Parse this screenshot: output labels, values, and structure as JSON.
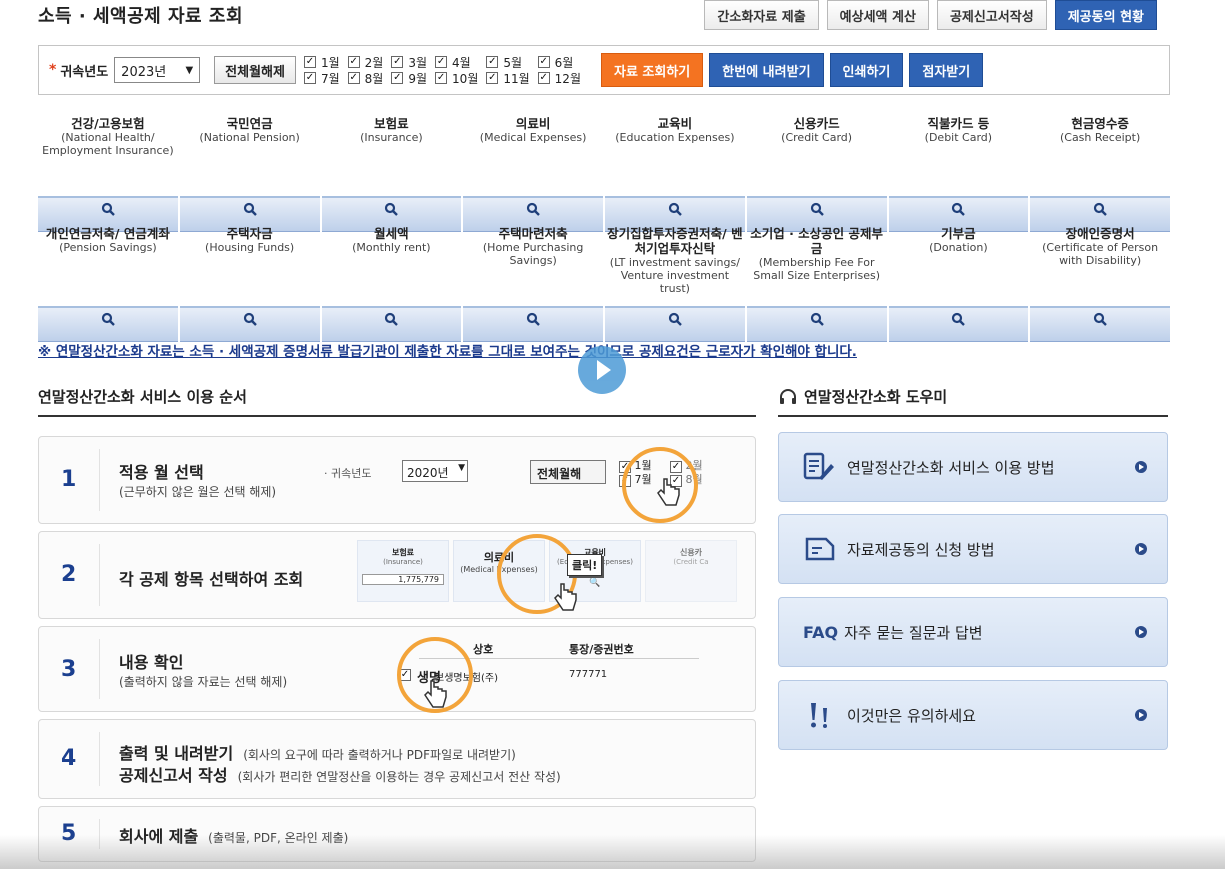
{
  "header": {
    "title": "소득 · 세액공제 자료 조회",
    "buttons": [
      "간소화자료 제출",
      "예상세액 계산",
      "공제신고서작성",
      "제공동의 현황"
    ]
  },
  "filter": {
    "year_label": "귀속년도",
    "year_value": "2023년",
    "all_off_label": "전체월해제",
    "months": [
      "1월",
      "2월",
      "3월",
      "4월",
      "5월",
      "6월",
      "7월",
      "8월",
      "9월",
      "10월",
      "11월",
      "12월"
    ],
    "actions": [
      "자료 조회하기",
      "한번에 내려받기",
      "인쇄하기",
      "점자받기"
    ]
  },
  "categories_row1": [
    {
      "title": "건강/고용보험",
      "sub": "(National Health/ Employment Insurance)"
    },
    {
      "title": "국민연금",
      "sub": "(National Pension)"
    },
    {
      "title": "보험료",
      "sub": "(Insurance)"
    },
    {
      "title": "의료비",
      "sub": "(Medical Expenses)"
    },
    {
      "title": "교육비",
      "sub": "(Education Expenses)"
    },
    {
      "title": "신용카드",
      "sub": "(Credit Card)"
    },
    {
      "title": "직불카드 등",
      "sub": "(Debit Card)"
    },
    {
      "title": "현금영수증",
      "sub": "(Cash Receipt)"
    }
  ],
  "categories_row2": [
    {
      "title": "개인연금저축/ 연금계좌",
      "sub": "(Pension Savings)"
    },
    {
      "title": "주택자금",
      "sub": "(Housing Funds)"
    },
    {
      "title": "월세액",
      "sub": "(Monthly rent)"
    },
    {
      "title": "주택마련저축",
      "sub": "(Home Purchasing Savings)"
    },
    {
      "title": "장기집합투자증권저축/ 벤처기업투자신탁",
      "sub": "(LT investment savings/ Venture investment trust)"
    },
    {
      "title": "소기업 · 소상공인 공제부금",
      "sub": "(Membership Fee For Small Size Enterprises)"
    },
    {
      "title": "기부금",
      "sub": "(Donation)"
    },
    {
      "title": "장애인증명서",
      "sub": "(Certificate of Person with Disability)"
    }
  ],
  "notice": "※ 연말정산간소화 자료는 소득 · 세액공제 증명서류 발급기관이 제출한 자료를 그대로 보여주는 것이므로 공제요건은 근로자가 확인해야 합니다.",
  "guide": {
    "heading": "연말정산간소화 서비스 이용 순서",
    "steps": [
      {
        "num": "1",
        "title": "적용 월 선택",
        "desc": "(근무하지 않은 월은 선택 해제)"
      },
      {
        "num": "2",
        "title": "각 공제 항목 선택하여 조회",
        "desc": ""
      },
      {
        "num": "3",
        "title": "내용 확인",
        "desc": "(출력하지 않을 자료는 선택 해제)"
      },
      {
        "num": "4",
        "title": "출력 및 내려받기",
        "desc": "(회사의 요구에 따라 출력하거나 PDF파일로 내려받기)",
        "title2": "공제신고서 작성",
        "desc2": "(회사가 편리한 연말정산을 이용하는 경우 공제신고서 전산 작성)"
      },
      {
        "num": "5",
        "title": "회사에 제출",
        "desc": "(출력물, PDF, 온라인 제출)"
      }
    ],
    "illus1": {
      "year_label": "· 귀속년도",
      "year_value": "2020년",
      "btn": "전체월해",
      "m1": "1월",
      "m7": "7월",
      "m2": "2월",
      "m8": "8월"
    },
    "illus2": {
      "c1_title": "보험료",
      "c1_sub": "(Insurance)",
      "c1_value": "1,775,779",
      "c2_title": "의료비",
      "c2_sub": "(Medical Expenses)",
      "c3_title": "교육비",
      "c3_sub": "(Education Expenses)",
      "c4_title": "신용카",
      "c4_sub": "(Credit Ca",
      "tooltip": "클릭!"
    },
    "illus3": {
      "col1": "상호",
      "col2": "통장/증권번호",
      "row1_name": "보생명보험(주)",
      "row1_num": "777771",
      "highlight": "생명"
    }
  },
  "helper": {
    "heading": "연말정산간소화 도우미",
    "items": [
      {
        "label": "연말정산간소화 서비스 이용 방법",
        "icon": "document-pen-icon"
      },
      {
        "label": "자료제공동의 신청 방법",
        "icon": "document-icon"
      },
      {
        "label": "자주 묻는 질문과 답변",
        "icon": "faq-icon",
        "prefix": "FAQ"
      },
      {
        "label": "이것만은 유의하세요",
        "icon": "exclamation-icon"
      }
    ]
  },
  "colors": {
    "accent_blue": "#2f63b4",
    "orange": "#f47321",
    "navy": "#1b3f8f"
  }
}
